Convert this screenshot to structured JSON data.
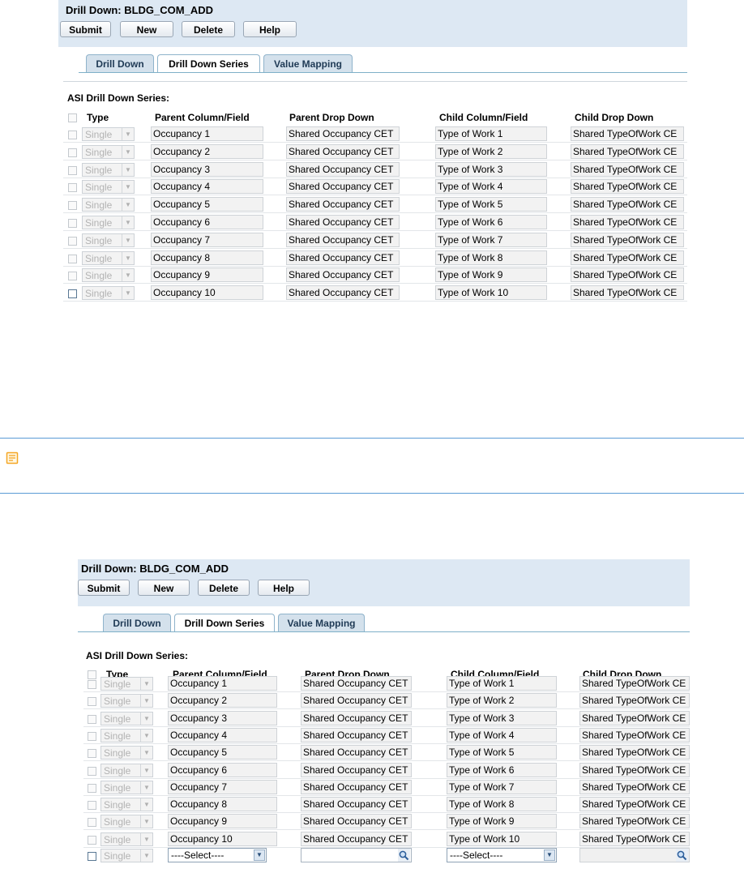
{
  "form": {
    "title": "Drill Down: BLDG_COM_ADD",
    "buttons": {
      "submit": "Submit",
      "new": "New",
      "delete": "Delete",
      "help": "Help"
    },
    "tabs": {
      "drill_down": "Drill Down",
      "drill_down_series": "Drill Down Series",
      "value_mapping": "Value Mapping"
    },
    "active_tab": "Drill Down Series",
    "section_title": "ASI Drill Down Series:",
    "columns": {
      "type": "Type",
      "parent_col": "Parent Column/Field",
      "parent_dd": "Parent Drop Down",
      "child_col": "Child Column/Field",
      "child_dd": "Child Drop Down"
    },
    "rows": [
      {
        "type": "Single",
        "parent_col": "Occupancy 1",
        "parent_dd": "Shared Occupancy CET",
        "child_col": "Type of Work 1",
        "child_dd": "Shared TypeOfWork CE"
      },
      {
        "type": "Single",
        "parent_col": "Occupancy 2",
        "parent_dd": "Shared Occupancy CET",
        "child_col": "Type of Work 2",
        "child_dd": "Shared TypeOfWork CE"
      },
      {
        "type": "Single",
        "parent_col": "Occupancy 3",
        "parent_dd": "Shared Occupancy CET",
        "child_col": "Type of Work 3",
        "child_dd": "Shared TypeOfWork CE"
      },
      {
        "type": "Single",
        "parent_col": "Occupancy 4",
        "parent_dd": "Shared Occupancy CET",
        "child_col": "Type of Work 4",
        "child_dd": "Shared TypeOfWork CE"
      },
      {
        "type": "Single",
        "parent_col": "Occupancy 5",
        "parent_dd": "Shared Occupancy CET",
        "child_col": "Type of Work 5",
        "child_dd": "Shared TypeOfWork CE"
      },
      {
        "type": "Single",
        "parent_col": "Occupancy 6",
        "parent_dd": "Shared Occupancy CET",
        "child_col": "Type of Work 6",
        "child_dd": "Shared TypeOfWork CE"
      },
      {
        "type": "Single",
        "parent_col": "Occupancy 7",
        "parent_dd": "Shared Occupancy CET",
        "child_col": "Type of Work 7",
        "child_dd": "Shared TypeOfWork CE"
      },
      {
        "type": "Single",
        "parent_col": "Occupancy 8",
        "parent_dd": "Shared Occupancy CET",
        "child_col": "Type of Work 8",
        "child_dd": "Shared TypeOfWork CE"
      },
      {
        "type": "Single",
        "parent_col": "Occupancy 9",
        "parent_dd": "Shared Occupancy CET",
        "child_col": "Type of Work 9",
        "child_dd": "Shared TypeOfWork CE"
      },
      {
        "type": "Single",
        "parent_col": "Occupancy 10",
        "parent_dd": "Shared Occupancy CET",
        "child_col": "Type of Work 10",
        "child_dd": "Shared TypeOfWork CE"
      }
    ],
    "new_row": {
      "type": "Single",
      "parent_col_select": "----Select----",
      "parent_dd_value": "",
      "child_col_select": "----Select----",
      "child_dd_value": ""
    }
  },
  "note_icon": "note-icon",
  "colors": {
    "header_bg": "#dde8f3",
    "tab_bg": "#d4e1ec",
    "note_rule": "#5b9bd5",
    "note_icon": "#f5a623"
  }
}
